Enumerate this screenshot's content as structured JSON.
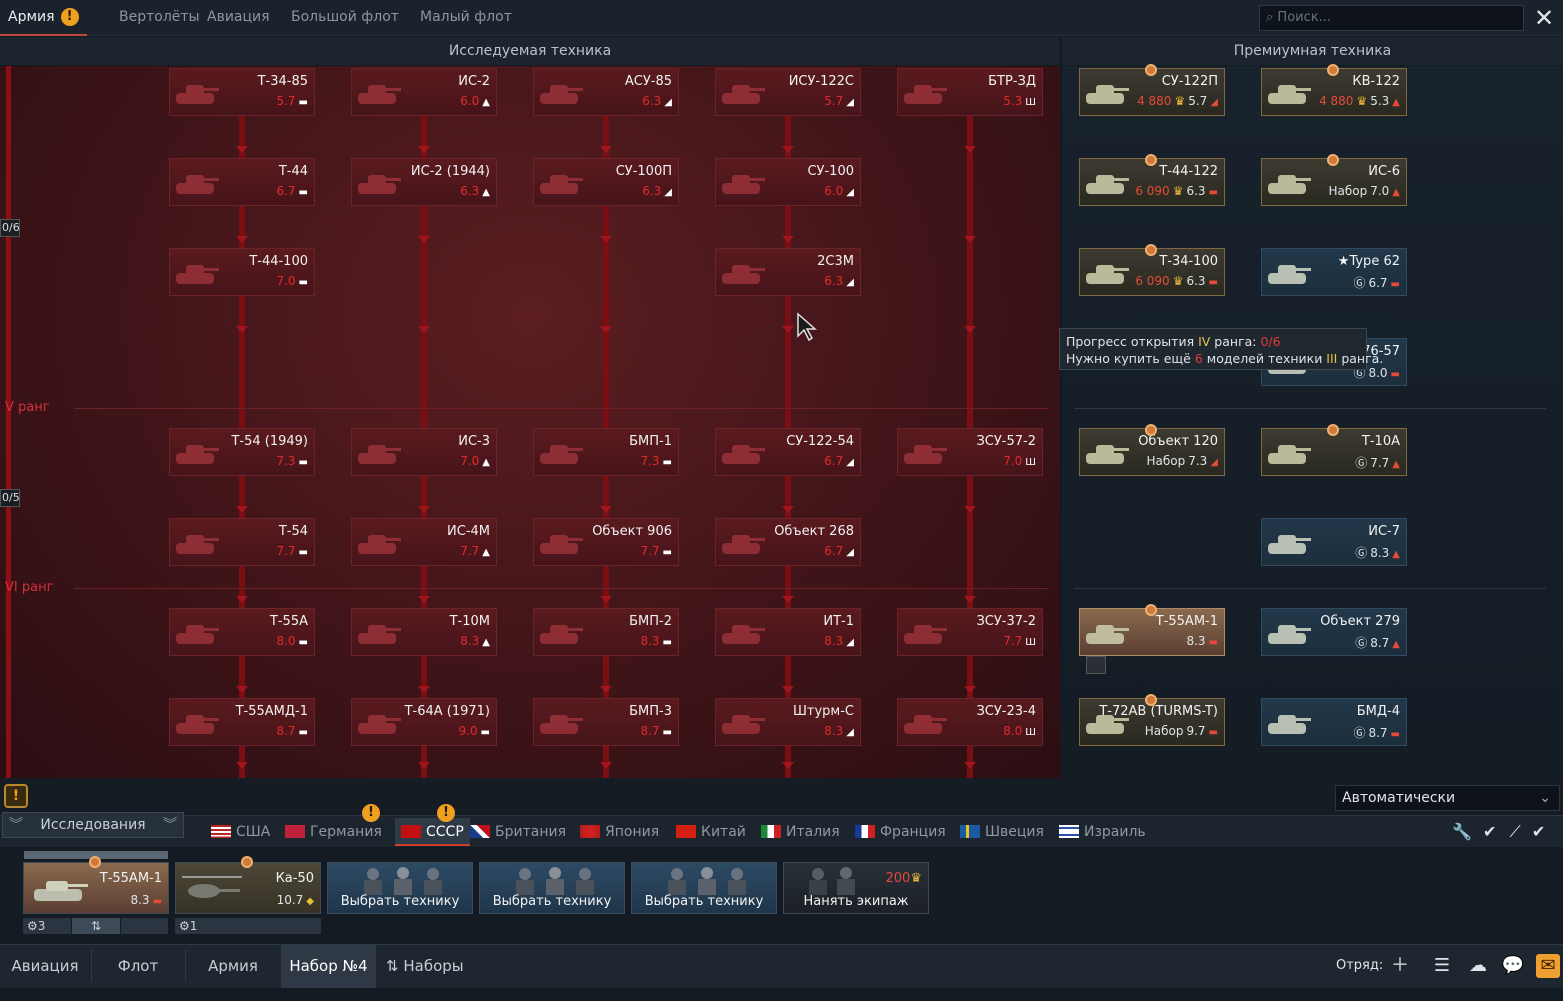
{
  "top_tabs": [
    {
      "label": "Армия",
      "active": true
    },
    {
      "label": "Вертолёты"
    },
    {
      "label": "Авиация"
    },
    {
      "label": "Большой флот"
    },
    {
      "label": "Малый флот"
    }
  ],
  "search": {
    "placeholder": "⌕ Поиск..."
  },
  "close_label": "✕",
  "headers": {
    "research": "Исследуемая техника",
    "premium": "Премиумная техника"
  },
  "ranks": [
    {
      "label": "V ранг",
      "progress": "0/5"
    },
    {
      "label": "VI ранг",
      "progress": ""
    }
  ],
  "rank_progress_top": "0/6",
  "research_cards": [
    {
      "name": "Т-34-85",
      "br": "5.7",
      "cls": "▬"
    },
    {
      "name": "ИС-2",
      "br": "6.0",
      "cls": "▲"
    },
    {
      "name": "АСУ-85",
      "br": "6.3",
      "cls": "◢"
    },
    {
      "name": "ИСУ-122С",
      "br": "5.7",
      "cls": "◢"
    },
    {
      "name": "БТР-ЗД",
      "br": "5.3",
      "cls": "Ш"
    },
    {
      "name": "Т-44",
      "br": "6.7",
      "cls": "▬"
    },
    {
      "name": "ИС-2 (1944)",
      "br": "6.3",
      "cls": "▲"
    },
    {
      "name": "СУ-100П",
      "br": "6.3",
      "cls": "◢"
    },
    {
      "name": "СУ-100",
      "br": "6.0",
      "cls": "◢"
    },
    {
      "name": "Т-44-100",
      "br": "7.0",
      "cls": "▬"
    },
    {
      "name": "2С3М",
      "br": "6.3",
      "cls": "◢"
    },
    {
      "name": "Т-54 (1949)",
      "br": "7.3",
      "cls": "▬"
    },
    {
      "name": "ИС-3",
      "br": "7.0",
      "cls": "▲"
    },
    {
      "name": "БМП-1",
      "br": "7.3",
      "cls": "▬"
    },
    {
      "name": "СУ-122-54",
      "br": "6.7",
      "cls": "◢"
    },
    {
      "name": "ЗСУ-57-2",
      "br": "7.0",
      "cls": "Ш"
    },
    {
      "name": "Т-54",
      "br": "7.7",
      "cls": "▬"
    },
    {
      "name": "ИС-4М",
      "br": "7.7",
      "cls": "▲"
    },
    {
      "name": "Объект 906",
      "br": "7.7",
      "cls": "▬"
    },
    {
      "name": "Объект 268",
      "br": "6.7",
      "cls": "◢"
    },
    {
      "name": "Т-55А",
      "br": "8.0",
      "cls": "▬"
    },
    {
      "name": "Т-10М",
      "br": "8.3",
      "cls": "▲"
    },
    {
      "name": "БМП-2",
      "br": "8.3",
      "cls": "▬"
    },
    {
      "name": "ИТ-1",
      "br": "8.3",
      "cls": "◢"
    },
    {
      "name": "ЗСУ-37-2",
      "br": "7.7",
      "cls": "Ш"
    },
    {
      "name": "Т-55АМД-1",
      "br": "8.7",
      "cls": "▬"
    },
    {
      "name": "Т-64А (1971)",
      "br": "9.0",
      "cls": "▬"
    },
    {
      "name": "БМП-3",
      "br": "8.7",
      "cls": "▬"
    },
    {
      "name": "Штурм-С",
      "br": "8.3",
      "cls": "◢"
    },
    {
      "name": "ЗСУ-23-4",
      "br": "8.0",
      "cls": "Ш"
    }
  ],
  "premium_cards": [
    {
      "name": "СУ-122П",
      "price": "4 880",
      "br": "5.7",
      "cls": "◢",
      "style": "gold"
    },
    {
      "name": "КВ-122",
      "price": "4 880",
      "br": "5.3",
      "cls": "▲",
      "style": "gold"
    },
    {
      "name": "Т-44-122",
      "price": "6 090",
      "br": "6.3",
      "cls": "▬",
      "style": "gold"
    },
    {
      "name": "ИС-6",
      "price": "Набор",
      "br": "7.0",
      "cls": "▲",
      "style": "gold"
    },
    {
      "name": "Т-34-100",
      "price": "6 090",
      "br": "6.3",
      "cls": "▬",
      "style": "gold"
    },
    {
      "name": "★Type 62",
      "price": "Ⓖ",
      "br": "6.7",
      "cls": "▬",
      "style": "blue"
    },
    {
      "name": "76-57",
      "price": "Ⓖ",
      "br": "8.0",
      "cls": "▬",
      "style": "blue"
    },
    {
      "name": "Объект 120",
      "price": "Набор",
      "br": "7.3",
      "cls": "◢",
      "style": "gold"
    },
    {
      "name": "Т-10А",
      "price": "Ⓖ",
      "br": "7.7",
      "cls": "▲",
      "style": "gold"
    },
    {
      "name": "ИС-7",
      "price": "Ⓖ",
      "br": "8.3",
      "cls": "▲",
      "style": "blue"
    },
    {
      "name": "Т-55АМ-1",
      "price": "",
      "br": "8.3",
      "cls": "▬",
      "style": "active"
    },
    {
      "name": "Объект 279",
      "price": "Ⓖ",
      "br": "8.7",
      "cls": "▲",
      "style": "blue"
    },
    {
      "name": "Т-72АВ (TURMS-T)",
      "price": "Набор",
      "br": "9.7",
      "cls": "▬",
      "style": "gold"
    },
    {
      "name": "БМД-4",
      "price": "Ⓖ",
      "br": "8.7",
      "cls": "▬",
      "style": "blue"
    }
  ],
  "tooltip": {
    "line1_prefix": "Прогресс открытия ",
    "line1_rank": "IV",
    "line1_mid": " ранга: ",
    "line1_value": "0/6",
    "line2_prefix": "Нужно купить ещё ",
    "line2_count": "6",
    "line2_mid": " моделей техники ",
    "line2_rank": "III",
    "line2_suffix": " ранга."
  },
  "auto_select": "Автоматически",
  "research_button": "Исследования",
  "nations": [
    {
      "label": "США",
      "active": false
    },
    {
      "label": "Германия",
      "active": false
    },
    {
      "label": "СССР",
      "active": true
    },
    {
      "label": "Британия",
      "active": false
    },
    {
      "label": "Япония",
      "active": false
    },
    {
      "label": "Китай",
      "active": false
    },
    {
      "label": "Италия",
      "active": false
    },
    {
      "label": "Франция",
      "active": false
    },
    {
      "label": "Швеция",
      "active": false
    },
    {
      "label": "Израиль",
      "active": false
    }
  ],
  "crew_slots": [
    {
      "name": "Т-55АМ-1",
      "br": "8.3",
      "crew": "3"
    },
    {
      "name": "Ка-50",
      "br": "10.7",
      "crew": "1"
    }
  ],
  "choose_vehicle": "Выбрать технику",
  "hire_crew": {
    "label": "Нанять экипаж",
    "price": "200"
  },
  "bottom_tabs": [
    {
      "label": "Авиация"
    },
    {
      "label": "Флот"
    },
    {
      "label": "Армия"
    },
    {
      "label": "Набор №4",
      "active": true
    },
    {
      "label": "Наборы"
    }
  ],
  "squad_label": "Отряд:"
}
